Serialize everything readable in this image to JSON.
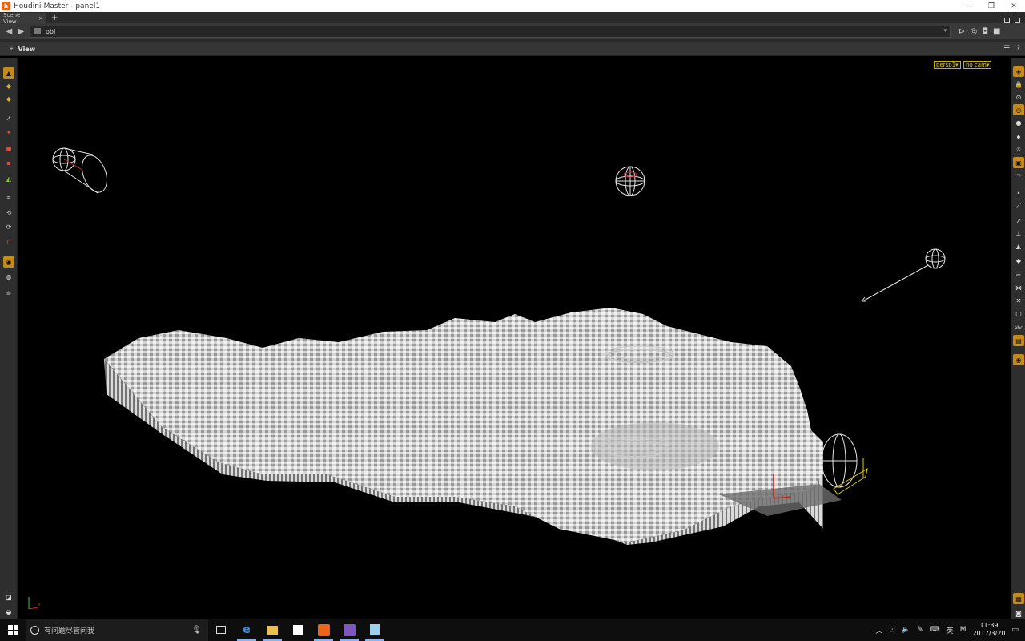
{
  "window": {
    "title": "Houdini-Master - panel1",
    "logo_letter": "h",
    "controls": [
      "—",
      "❐",
      "✕"
    ]
  },
  "tabs": [
    {
      "label": "Scene View",
      "close": "×"
    }
  ],
  "tab_add": "+",
  "pathbar": {
    "path": "obj",
    "back_icon": "arrow-left-icon",
    "forward_icon": "arrow-right-icon"
  },
  "panel": {
    "label": "View"
  },
  "viewport": {
    "camera_menu": "persp1▾",
    "cam_menu": "no cam▾",
    "axis_x": "x"
  },
  "taskbar": {
    "search_placeholder": "有问题尽管问我",
    "apps": [
      "task-view",
      "edge",
      "file-explorer",
      "store",
      "houdini",
      "visual-studio",
      "notepad"
    ],
    "tray": {
      "ime": "英",
      "ime2": "M",
      "time": "11:39",
      "date": "2017/3/20"
    }
  },
  "colors": {
    "accent": "#c48a1c",
    "chip": "#d8c400",
    "terrain": "#d9d9d9"
  }
}
